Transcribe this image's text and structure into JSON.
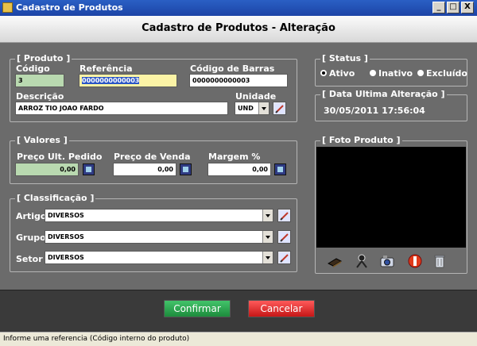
{
  "window": {
    "title": "Cadastro de Produtos",
    "minimize": "_",
    "maximize": "□",
    "close": "X"
  },
  "header": {
    "title": "Cadastro de Produtos - Alteração"
  },
  "produto": {
    "legend": "[ Produto ]",
    "codigo_label": "Código",
    "codigo_value": "3",
    "referencia_label": "Referência",
    "referencia_value": "0000000000003",
    "barras_label": "Código de Barras",
    "barras_value": "0000000000003",
    "descricao_label": "Descrição",
    "descricao_value": "ARROZ TIO JOAO FARDO",
    "unidade_label": "Unidade",
    "unidade_value": "UND"
  },
  "status": {
    "legend": "[ Status ]",
    "options": [
      "Ativo",
      "Inativo",
      "Excluído"
    ],
    "selected": "Ativo"
  },
  "alteracao": {
    "legend": "[ Data Ultima Alteração ]",
    "value": "30/05/2011 17:56:04"
  },
  "valores": {
    "legend": "[ Valores ]",
    "preco_pedido_label": "Preço Ult. Pedido",
    "preco_pedido_value": "0,00",
    "preco_venda_label": "Preço de Venda",
    "preco_venda_value": "0,00",
    "margem_label": "Margem %",
    "margem_value": "0,00"
  },
  "classificacao": {
    "legend": "[ Classificação ]",
    "artigo_label": "Artigo",
    "artigo_value": "DIVERSOS",
    "grupo_label": "Grupo",
    "grupo_value": "DIVERSOS",
    "setor_label": "Setor",
    "setor_value": "DIVERSOS"
  },
  "foto": {
    "legend": "[ Foto Produto ]",
    "toolbar_icons": [
      "scanner-icon",
      "camera-stand-icon",
      "camera-icon",
      "delete-photo-icon",
      "trash-icon"
    ]
  },
  "actions": {
    "confirm": "Confirmar",
    "cancel": "Cancelar"
  },
  "statusbar": {
    "text": "Informe uma referencia (Código interno do produto)"
  },
  "colors": {
    "titlebar": "#1c44a6",
    "confirm": "#1d8b3c",
    "cancel": "#c51616",
    "background": "#6b6b6b"
  }
}
